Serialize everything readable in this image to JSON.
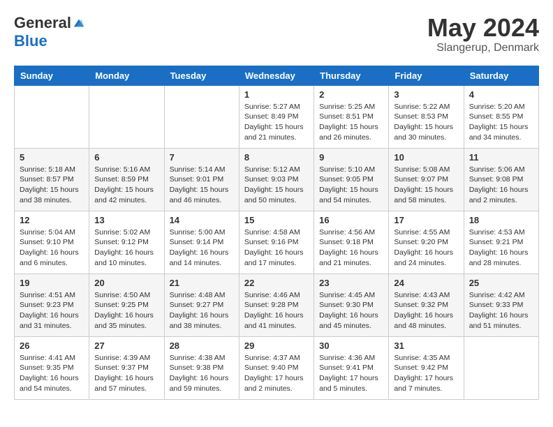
{
  "header": {
    "logo_general": "General",
    "logo_blue": "Blue",
    "month_title": "May 2024",
    "location": "Slangerup, Denmark"
  },
  "calendar": {
    "days_of_week": [
      "Sunday",
      "Monday",
      "Tuesday",
      "Wednesday",
      "Thursday",
      "Friday",
      "Saturday"
    ],
    "weeks": [
      [
        {
          "day": "",
          "info": ""
        },
        {
          "day": "",
          "info": ""
        },
        {
          "day": "",
          "info": ""
        },
        {
          "day": "1",
          "info": "Sunrise: 5:27 AM\nSunset: 8:49 PM\nDaylight: 15 hours\nand 21 minutes."
        },
        {
          "day": "2",
          "info": "Sunrise: 5:25 AM\nSunset: 8:51 PM\nDaylight: 15 hours\nand 26 minutes."
        },
        {
          "day": "3",
          "info": "Sunrise: 5:22 AM\nSunset: 8:53 PM\nDaylight: 15 hours\nand 30 minutes."
        },
        {
          "day": "4",
          "info": "Sunrise: 5:20 AM\nSunset: 8:55 PM\nDaylight: 15 hours\nand 34 minutes."
        }
      ],
      [
        {
          "day": "5",
          "info": "Sunrise: 5:18 AM\nSunset: 8:57 PM\nDaylight: 15 hours\nand 38 minutes."
        },
        {
          "day": "6",
          "info": "Sunrise: 5:16 AM\nSunset: 8:59 PM\nDaylight: 15 hours\nand 42 minutes."
        },
        {
          "day": "7",
          "info": "Sunrise: 5:14 AM\nSunset: 9:01 PM\nDaylight: 15 hours\nand 46 minutes."
        },
        {
          "day": "8",
          "info": "Sunrise: 5:12 AM\nSunset: 9:03 PM\nDaylight: 15 hours\nand 50 minutes."
        },
        {
          "day": "9",
          "info": "Sunrise: 5:10 AM\nSunset: 9:05 PM\nDaylight: 15 hours\nand 54 minutes."
        },
        {
          "day": "10",
          "info": "Sunrise: 5:08 AM\nSunset: 9:07 PM\nDaylight: 15 hours\nand 58 minutes."
        },
        {
          "day": "11",
          "info": "Sunrise: 5:06 AM\nSunset: 9:08 PM\nDaylight: 16 hours\nand 2 minutes."
        }
      ],
      [
        {
          "day": "12",
          "info": "Sunrise: 5:04 AM\nSunset: 9:10 PM\nDaylight: 16 hours\nand 6 minutes."
        },
        {
          "day": "13",
          "info": "Sunrise: 5:02 AM\nSunset: 9:12 PM\nDaylight: 16 hours\nand 10 minutes."
        },
        {
          "day": "14",
          "info": "Sunrise: 5:00 AM\nSunset: 9:14 PM\nDaylight: 16 hours\nand 14 minutes."
        },
        {
          "day": "15",
          "info": "Sunrise: 4:58 AM\nSunset: 9:16 PM\nDaylight: 16 hours\nand 17 minutes."
        },
        {
          "day": "16",
          "info": "Sunrise: 4:56 AM\nSunset: 9:18 PM\nDaylight: 16 hours\nand 21 minutes."
        },
        {
          "day": "17",
          "info": "Sunrise: 4:55 AM\nSunset: 9:20 PM\nDaylight: 16 hours\nand 24 minutes."
        },
        {
          "day": "18",
          "info": "Sunrise: 4:53 AM\nSunset: 9:21 PM\nDaylight: 16 hours\nand 28 minutes."
        }
      ],
      [
        {
          "day": "19",
          "info": "Sunrise: 4:51 AM\nSunset: 9:23 PM\nDaylight: 16 hours\nand 31 minutes."
        },
        {
          "day": "20",
          "info": "Sunrise: 4:50 AM\nSunset: 9:25 PM\nDaylight: 16 hours\nand 35 minutes."
        },
        {
          "day": "21",
          "info": "Sunrise: 4:48 AM\nSunset: 9:27 PM\nDaylight: 16 hours\nand 38 minutes."
        },
        {
          "day": "22",
          "info": "Sunrise: 4:46 AM\nSunset: 9:28 PM\nDaylight: 16 hours\nand 41 minutes."
        },
        {
          "day": "23",
          "info": "Sunrise: 4:45 AM\nSunset: 9:30 PM\nDaylight: 16 hours\nand 45 minutes."
        },
        {
          "day": "24",
          "info": "Sunrise: 4:43 AM\nSunset: 9:32 PM\nDaylight: 16 hours\nand 48 minutes."
        },
        {
          "day": "25",
          "info": "Sunrise: 4:42 AM\nSunset: 9:33 PM\nDaylight: 16 hours\nand 51 minutes."
        }
      ],
      [
        {
          "day": "26",
          "info": "Sunrise: 4:41 AM\nSunset: 9:35 PM\nDaylight: 16 hours\nand 54 minutes."
        },
        {
          "day": "27",
          "info": "Sunrise: 4:39 AM\nSunset: 9:37 PM\nDaylight: 16 hours\nand 57 minutes."
        },
        {
          "day": "28",
          "info": "Sunrise: 4:38 AM\nSunset: 9:38 PM\nDaylight: 16 hours\nand 59 minutes."
        },
        {
          "day": "29",
          "info": "Sunrise: 4:37 AM\nSunset: 9:40 PM\nDaylight: 17 hours\nand 2 minutes."
        },
        {
          "day": "30",
          "info": "Sunrise: 4:36 AM\nSunset: 9:41 PM\nDaylight: 17 hours\nand 5 minutes."
        },
        {
          "day": "31",
          "info": "Sunrise: 4:35 AM\nSunset: 9:42 PM\nDaylight: 17 hours\nand 7 minutes."
        },
        {
          "day": "",
          "info": ""
        }
      ]
    ]
  }
}
